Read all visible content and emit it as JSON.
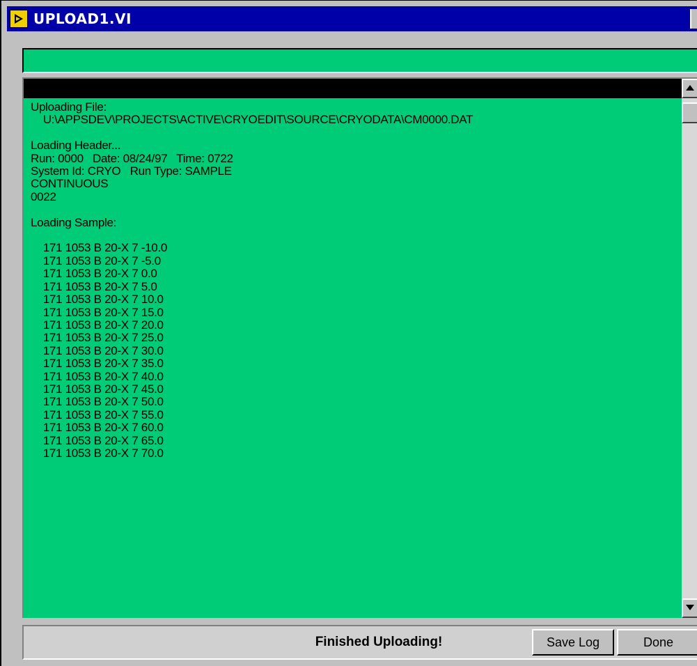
{
  "window": {
    "title": "UPLOAD1.VI"
  },
  "status_message": "",
  "log": {
    "lines": [
      "Uploading File:",
      "    U:\\APPSDEV\\PROJECTS\\ACTIVE\\CRYOEDIT\\SOURCE\\CRYODATA\\CM0000.DAT",
      "",
      "Loading Header...",
      "Run: 0000   Date: 08/24/97   Time: 0722",
      "System Id: CRYO   Run Type: SAMPLE",
      "CONTINUOUS",
      "0022",
      "",
      "Loading Sample:",
      "",
      "    171 1053 B 20-X 7 -10.0",
      "    171 1053 B 20-X 7 -5.0",
      "    171 1053 B 20-X 7 0.0",
      "    171 1053 B 20-X 7 5.0",
      "    171 1053 B 20-X 7 10.0",
      "    171 1053 B 20-X 7 15.0",
      "    171 1053 B 20-X 7 20.0",
      "    171 1053 B 20-X 7 25.0",
      "    171 1053 B 20-X 7 30.0",
      "    171 1053 B 20-X 7 35.0",
      "    171 1053 B 20-X 7 40.0",
      "    171 1053 B 20-X 7 45.0",
      "    171 1053 B 20-X 7 50.0",
      "    171 1053 B 20-X 7 55.0",
      "    171 1053 B 20-X 7 60.0",
      "    171 1053 B 20-X 7 65.0",
      "    171 1053 B 20-X 7 70.0"
    ]
  },
  "footer": {
    "status_text": "Finished Uploading!",
    "save_log_label": "Save Log",
    "done_label": "Done"
  },
  "icons": {
    "app": "labview-vi-icon",
    "scroll_up": "scroll-up-arrow-icon",
    "scroll_down": "scroll-down-arrow-icon"
  },
  "colors": {
    "title_bar": "#0000a8",
    "log_background": "#00cc77",
    "window_face": "#c0c0c0"
  }
}
